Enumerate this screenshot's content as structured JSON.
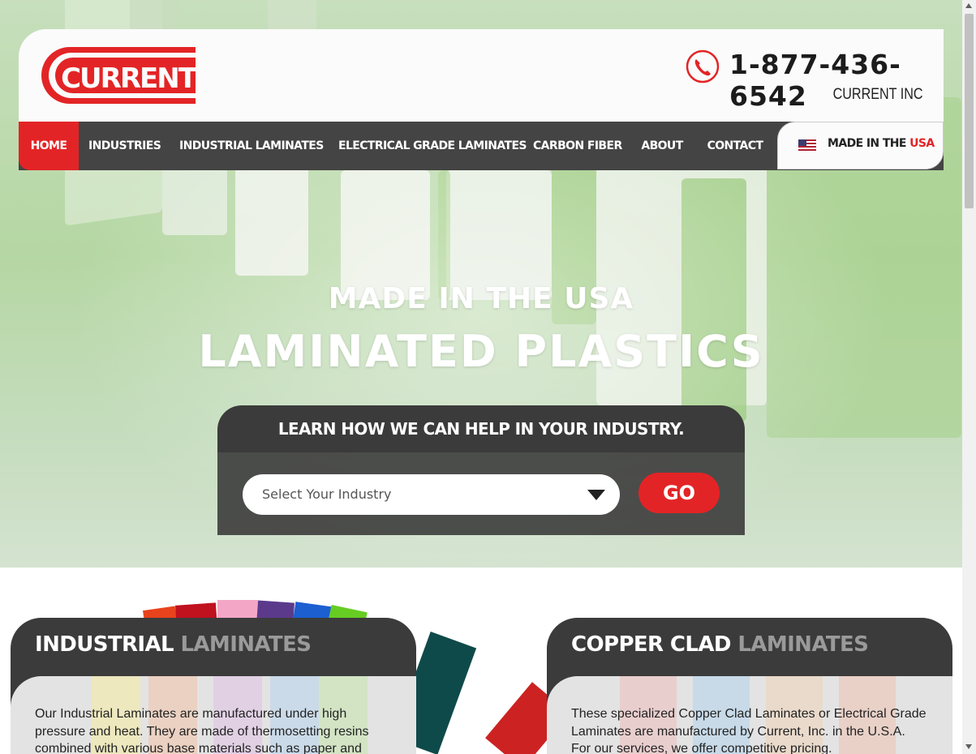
{
  "header": {
    "logo_text": "CURRENT",
    "phone": "1-877-436-6542",
    "company": "CURRENT INC"
  },
  "nav": {
    "items": [
      {
        "label": "HOME",
        "active": true
      },
      {
        "label": "INDUSTRIES"
      },
      {
        "label": "INDUSTRIAL LAMINATES"
      },
      {
        "label": "ELECTRICAL GRADE LAMINATES"
      },
      {
        "label": "CARBON FIBER"
      },
      {
        "label": "ABOUT"
      },
      {
        "label": "CONTACT"
      }
    ],
    "made_in": {
      "prefix": "MADE IN THE",
      "highlight": "USA"
    }
  },
  "hero": {
    "subtitle": "MADE IN THE USA",
    "title": "LAMINATED PLASTICS"
  },
  "industry_box": {
    "heading": "LEARN HOW WE CAN HELP IN YOUR INDUSTRY.",
    "select_placeholder": "Select Your Industry",
    "go_label": "GO"
  },
  "cards": [
    {
      "title_main": "INDUSTRIAL",
      "title_dim": "LAMINATES",
      "text": "Our Industrial Laminates are manufactured under high pressure and heat. They are made of thermosetting resins combined with various base materials such as paper and"
    },
    {
      "title_main": "COPPER CLAD",
      "title_dim": "LAMINATES",
      "text": "These specialized Copper Clad Laminates or Electrical Grade Laminates are manufactured by Current, Inc. in the U.S.A. For our services, we offer competitive pricing."
    }
  ],
  "colors": {
    "brand_red": "#e32426",
    "dark_gray": "#444444",
    "hero_green": "#b5d7a3"
  }
}
